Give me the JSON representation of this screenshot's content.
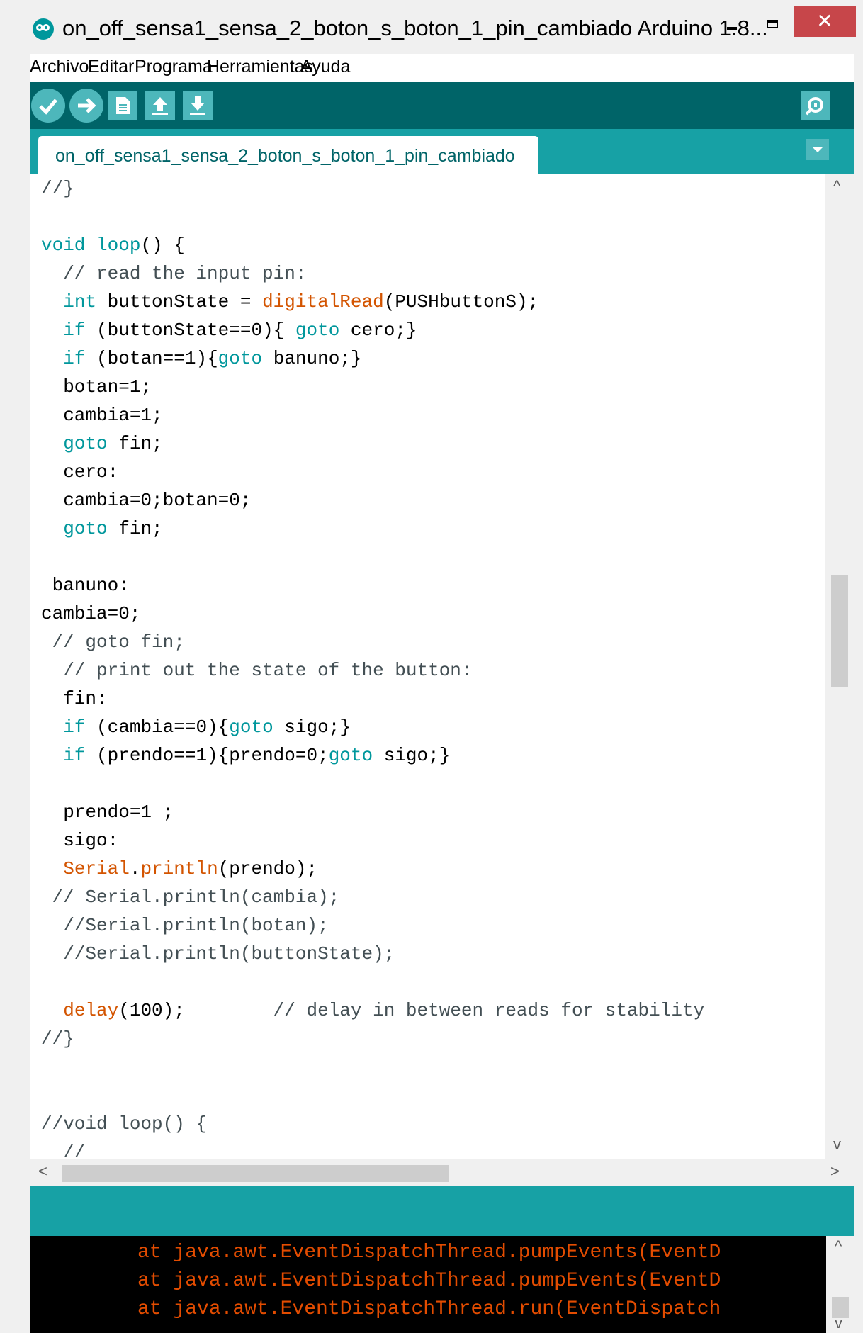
{
  "window": {
    "title": "on_off_sensa1_sensa_2_boton_s_boton_1_pin_cambiado Arduino 1.8...",
    "minimize_glyph": "",
    "maximize_glyph": "",
    "close_glyph": "✕"
  },
  "menu": [
    "Archivo",
    "Editar",
    "Programa",
    "Herramientas",
    "Ayuda"
  ],
  "toolbar": {
    "icons": [
      "verify-icon",
      "upload-icon",
      "new-icon",
      "open-icon",
      "save-icon",
      "serial-monitor-icon"
    ]
  },
  "tab": {
    "label": "on_off_sensa1_sensa_2_boton_s_boton_1_pin_cambiado"
  },
  "code_lines": [
    [
      {
        "t": "//}",
        "c": "c"
      }
    ],
    [],
    [
      {
        "t": "void",
        "c": "k"
      },
      {
        "t": " "
      },
      {
        "t": "loop",
        "c": "k"
      },
      {
        "t": "() {"
      }
    ],
    [
      {
        "t": "  // read the input pin:",
        "c": "c"
      }
    ],
    [
      {
        "t": "  "
      },
      {
        "t": "int",
        "c": "k"
      },
      {
        "t": " buttonState = "
      },
      {
        "t": "digitalRead",
        "c": "f"
      },
      {
        "t": "(PUSHbuttonS);"
      }
    ],
    [
      {
        "t": "  "
      },
      {
        "t": "if",
        "c": "k"
      },
      {
        "t": " (buttonState==0){ "
      },
      {
        "t": "goto",
        "c": "k"
      },
      {
        "t": " cero;}"
      }
    ],
    [
      {
        "t": "  "
      },
      {
        "t": "if",
        "c": "k"
      },
      {
        "t": " (botan==1){"
      },
      {
        "t": "goto",
        "c": "k"
      },
      {
        "t": " banuno;}"
      }
    ],
    [
      {
        "t": "  botan=1;"
      }
    ],
    [
      {
        "t": "  cambia=1;"
      }
    ],
    [
      {
        "t": "  "
      },
      {
        "t": "goto",
        "c": "k"
      },
      {
        "t": " fin;"
      }
    ],
    [
      {
        "t": "  cero:"
      }
    ],
    [
      {
        "t": "  cambia=0;botan=0;"
      }
    ],
    [
      {
        "t": "  "
      },
      {
        "t": "goto",
        "c": "k"
      },
      {
        "t": " fin;"
      }
    ],
    [],
    [
      {
        "t": " banuno:"
      }
    ],
    [
      {
        "t": "cambia=0;"
      }
    ],
    [
      {
        "t": " // goto fin;",
        "c": "c"
      }
    ],
    [
      {
        "t": "  // print out the state of the button:",
        "c": "c"
      }
    ],
    [
      {
        "t": "  fin:"
      }
    ],
    [
      {
        "t": "  "
      },
      {
        "t": "if",
        "c": "k"
      },
      {
        "t": " (cambia==0){"
      },
      {
        "t": "goto",
        "c": "k"
      },
      {
        "t": " sigo;}"
      }
    ],
    [
      {
        "t": "  "
      },
      {
        "t": "if",
        "c": "k"
      },
      {
        "t": " (prendo==1){prendo=0;"
      },
      {
        "t": "goto",
        "c": "k"
      },
      {
        "t": " sigo;}"
      }
    ],
    [],
    [
      {
        "t": "  prendo=1 ;"
      }
    ],
    [
      {
        "t": "  sigo:"
      }
    ],
    [
      {
        "t": "  "
      },
      {
        "t": "Serial",
        "c": "f"
      },
      {
        "t": "."
      },
      {
        "t": "println",
        "c": "f"
      },
      {
        "t": "(prendo);"
      }
    ],
    [
      {
        "t": " // Serial.println(cambia);",
        "c": "c"
      }
    ],
    [
      {
        "t": "  //Serial.println(botan);",
        "c": "c"
      }
    ],
    [
      {
        "t": "  //Serial.println(buttonState);",
        "c": "c"
      }
    ],
    [],
    [
      {
        "t": "  "
      },
      {
        "t": "delay",
        "c": "f"
      },
      {
        "t": "(100);        "
      },
      {
        "t": "// delay in between reads for stability",
        "c": "c"
      }
    ],
    [
      {
        "t": "//}",
        "c": "c"
      }
    ],
    [],
    [],
    [
      {
        "t": "//void loop() {",
        "c": "c"
      }
    ],
    [
      {
        "t": "  //",
        "c": "c"
      }
    ]
  ],
  "console_lines": [
    "at java.awt.EventDispatchThread.pumpEvents(EventD",
    "at java.awt.EventDispatchThread.pumpEvents(EventD",
    "at java.awt.EventDispatchThread.run(EventDispatch"
  ],
  "scroll_arrows": {
    "up": "^",
    "down": "v",
    "left": "<",
    "right": ">"
  },
  "colors": {
    "teal_dark": "#006468",
    "teal": "#17a1a5",
    "keyword": "#00979c",
    "function": "#d35400",
    "console_text": "#e34c00"
  }
}
